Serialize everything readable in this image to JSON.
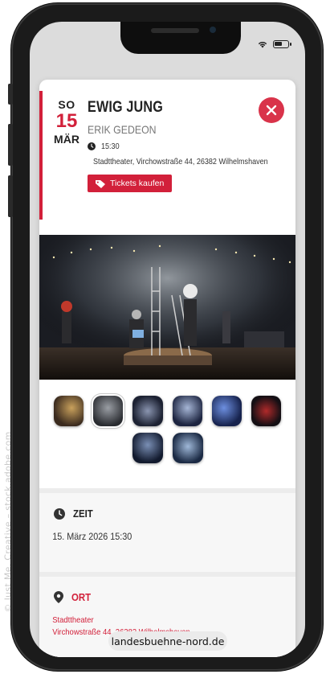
{
  "watermark": "© Just Me. Creative – stock.adobe.com",
  "event": {
    "day_of_week": "SO",
    "day": "15",
    "month": "MÄR",
    "title": "EWIG JUNG",
    "author": "ERIK GEDEON",
    "time": "15:30",
    "location": "Stadttheater, Virchowstraße 44, 26382 Wilhelmshaven",
    "tickets_label": "Tickets kaufen"
  },
  "icons": {
    "close": "close-icon",
    "clock": "clock-icon",
    "pin": "map-pin-icon",
    "tag": "ticket-tag-icon",
    "wifi": "wifi-icon",
    "battery": "battery-icon"
  },
  "gallery": {
    "thumbnail_count": 8,
    "active_index": 1
  },
  "zeit": {
    "label": "ZEIT",
    "value": "15. März 2026 15:30"
  },
  "ort": {
    "label": "ORT",
    "venue": "Stadttheater",
    "address": "Virchowstraße 44, 26382 Wilhelmshaven"
  },
  "url": "landesbuehne-nord.de",
  "colors": {
    "accent": "#d2203a",
    "frame": "#1b1b1b",
    "card": "#ffffff"
  }
}
